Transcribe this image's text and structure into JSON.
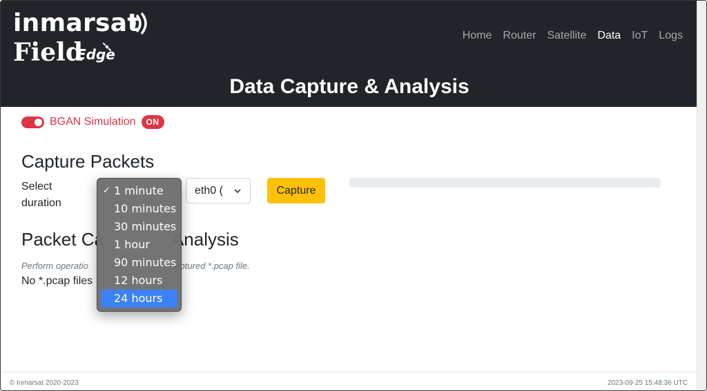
{
  "brand": {
    "name": "inmarsat",
    "product": "Field",
    "product_sub": "Edge"
  },
  "nav": [
    {
      "label": "Home",
      "active": false
    },
    {
      "label": "Router",
      "active": false
    },
    {
      "label": "Satellite",
      "active": false
    },
    {
      "label": "Data",
      "active": true
    },
    {
      "label": "IoT",
      "active": false
    },
    {
      "label": "Logs",
      "active": false
    }
  ],
  "page_title": "Data Capture & Analysis",
  "simulation": {
    "label": "BGAN Simulation",
    "badge": "ON",
    "enabled": true
  },
  "capture": {
    "heading": "Capture Packets",
    "select_label": "Select duration",
    "duration_options": [
      "1 minute",
      "10 minutes",
      "30 minutes",
      "1 hour",
      "90 minutes",
      "12 hours",
      "24 hours"
    ],
    "duration_selected": "1 minute",
    "duration_highlighted": "24 hours",
    "interface_value": "eth0 (",
    "capture_button": "Capture",
    "progress": 0
  },
  "analysis": {
    "heading_left": "Packet Ca",
    "heading_right": "Analysis",
    "desc_left": "Perform operatio",
    "desc_right": "captured *.pcap file.",
    "no_files": "No *.pcap files"
  },
  "footer": {
    "copyright": "© Inmarsat 2020-2023",
    "timestamp": "2023-09-25 15:48:36 UTC"
  },
  "colors": {
    "header_bg": "#212529",
    "danger": "#dc3545",
    "warning": "#ffc107",
    "highlight": "#3b82f6"
  }
}
